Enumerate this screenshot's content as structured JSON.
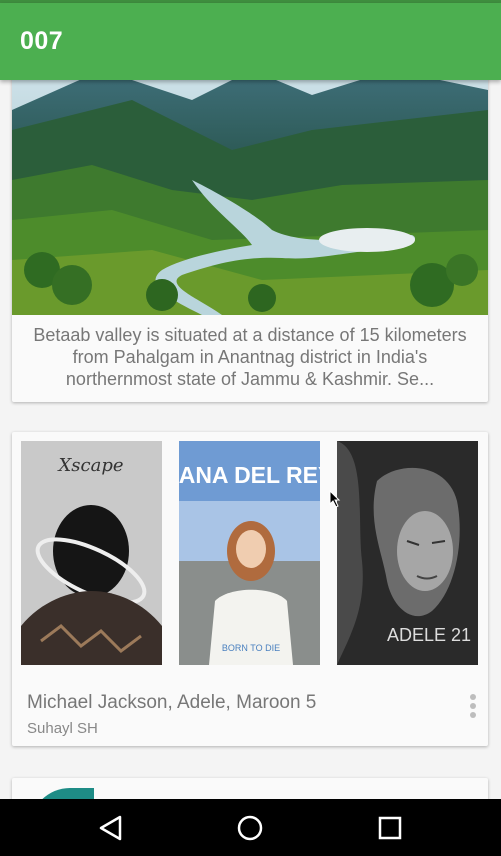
{
  "app_bar": {
    "title": "007"
  },
  "post_card": {
    "caption": "Betaab valley is situated at a distance of 15 kilometers from Pahalgam in Anantnag district in India's northernmost state of Jammu & Kashmir. Se..."
  },
  "album_card": {
    "names": "Michael Jackson, Adele, Maroon 5",
    "author": "Suhayl SH",
    "covers": [
      {
        "artist_text": "Xscape"
      },
      {
        "artist_text": "LANA DEL REY",
        "subtitle": "BORN TO DIE"
      },
      {
        "artist_text": "ADELE 21"
      }
    ]
  },
  "nav_bar": {
    "icons": [
      "back-icon",
      "home-icon",
      "recents-icon"
    ]
  },
  "colors": {
    "app_bar": "#4caf50",
    "status_bar": "#3f8e3f",
    "card": "#fafafa",
    "nav_bar": "#000000"
  }
}
